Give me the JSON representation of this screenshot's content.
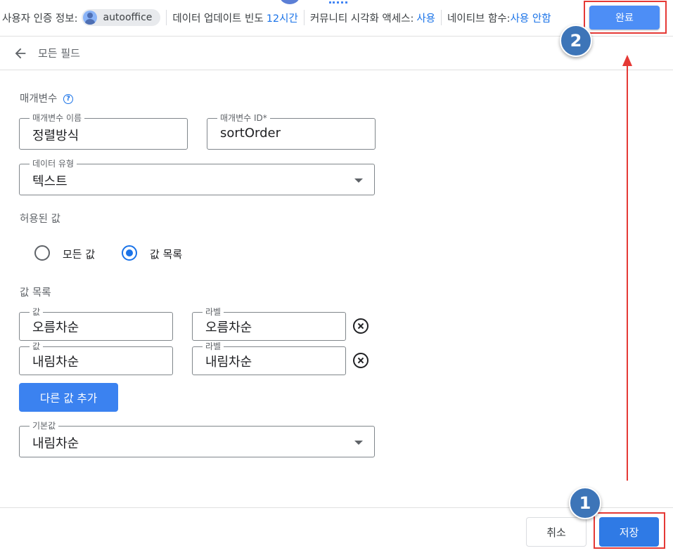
{
  "topbar": {
    "auth_label": "사용자 인증 정보:",
    "account_name": "autooffice",
    "freshness_label": "데이터 업데이트 빈도",
    "freshness_value": "12시간",
    "community_label": "커뮤니티 시각화 액세스:",
    "community_value": "사용",
    "native_label": "네이티브 함수:",
    "native_value": "사용 안함",
    "done_label": "완료"
  },
  "subheader": {
    "title": "모든 필드"
  },
  "form": {
    "params_label": "매개변수",
    "help_glyph": "?",
    "name_label": "매개변수 이름",
    "name_value": "정렬방식",
    "id_label": "매개변수 ID*",
    "id_value": "sortOrder",
    "data_type_label": "데이터 유형",
    "data_type_value": "텍스트",
    "allowed_values_label": "허용된 값",
    "radio_options": [
      {
        "label": "모든 값",
        "checked": false
      },
      {
        "label": "값 목록",
        "checked": true
      }
    ],
    "value_list_label": "값 목록",
    "value_rows": [
      {
        "value_label": "값",
        "value": "오름차순",
        "label_label": "라벨",
        "label": "오름차순"
      },
      {
        "value_label": "값",
        "value": "내림차순",
        "label_label": "라벨",
        "label": "내림차순"
      }
    ],
    "add_value_label": "다른 값 추가",
    "default_label": "기본값",
    "default_value": "내림차순"
  },
  "footer": {
    "cancel_label": "취소",
    "save_label": "저장"
  },
  "annotations": {
    "step1": "1",
    "step2": "2",
    "highlight_color": "#e53935",
    "badge_color": "#3d75b8"
  }
}
